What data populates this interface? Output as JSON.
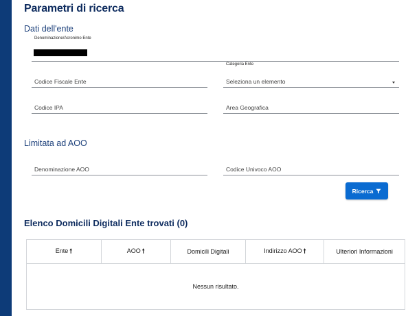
{
  "page": {
    "title": "Parametri di ricerca"
  },
  "ente_section": {
    "title": "Dati dell'ente",
    "denominazione": {
      "label": "Denominazione/Acronimo Ente",
      "value": ""
    },
    "codice_fiscale": {
      "placeholder": "Codice Fiscale Ente"
    },
    "categoria": {
      "label": "Categoria Ente",
      "selected": "Seleziona un elemento"
    },
    "codice_ipa": {
      "placeholder": "Codice IPA"
    },
    "area_geografica": {
      "placeholder": "Area Geografica"
    }
  },
  "aoo_section": {
    "title": "Limitata ad AOO",
    "denominazione_aoo": {
      "placeholder": "Denominazione AOO"
    },
    "codice_univoco_aoo": {
      "placeholder": "Codice Univoco AOO"
    }
  },
  "actions": {
    "search_label": "Ricerca",
    "search_icon": "filter-icon"
  },
  "results": {
    "title": "Elenco Domicili Digitali Ente trovati (0)",
    "columns": [
      {
        "label": "Ente",
        "sort_arrow": "🠕"
      },
      {
        "label": "AOO",
        "sort_arrow": "🠕"
      },
      {
        "label": "Domicili Digitali",
        "sort_arrow": ""
      },
      {
        "label": "Indirizzo AOO",
        "sort_arrow": "🠕"
      },
      {
        "label": "Ulteriori Informazioni",
        "sort_arrow": ""
      }
    ],
    "empty_message": "Nessun risultato."
  },
  "colors": {
    "sidebar": "#0d3b78",
    "title": "#0d2b5e",
    "button": "#0a6bd1"
  }
}
